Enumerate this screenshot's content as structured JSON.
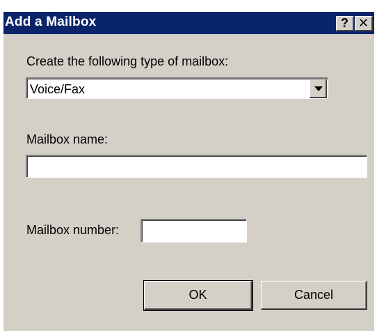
{
  "dialog": {
    "title": "Add a Mailbox",
    "help_button": "?",
    "close_button": "✕"
  },
  "type_section": {
    "label": "Create the following type of mailbox:",
    "selected": "Voice/Fax"
  },
  "name_section": {
    "label": "Mailbox name:",
    "value": ""
  },
  "number_section": {
    "label": "Mailbox number:",
    "value": ""
  },
  "buttons": {
    "ok": "OK",
    "cancel": "Cancel"
  },
  "colors": {
    "titlebar": "#0a246a",
    "dialog_face": "#d4d0c8"
  }
}
